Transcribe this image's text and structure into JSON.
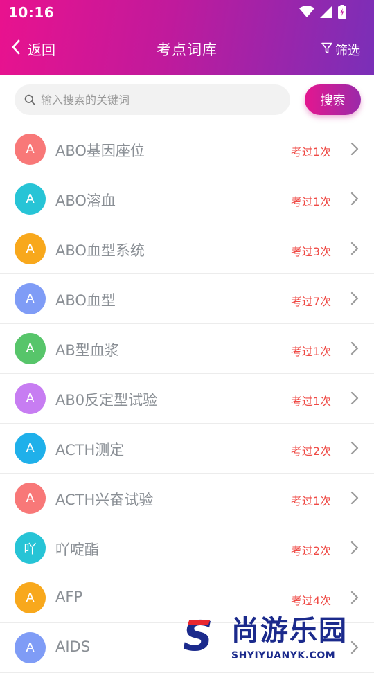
{
  "status_bar": {
    "time": "10:16"
  },
  "header": {
    "back_label": "返回",
    "title": "考点词库",
    "filter_label": "筛选"
  },
  "search": {
    "placeholder": "输入搜索的关键词",
    "value": "",
    "button_label": "搜索"
  },
  "colors": {
    "header_start": "#e9128e",
    "header_end": "#7a2fb8",
    "count_color": "#ef4a45"
  },
  "items": [
    {
      "initial": "A",
      "term": "ABO基因座位",
      "count": "考过1次",
      "color": "#f87878"
    },
    {
      "initial": "A",
      "term": "ABO溶血",
      "count": "考过1次",
      "color": "#27c4d6"
    },
    {
      "initial": "A",
      "term": "ABO血型系统",
      "count": "考过3次",
      "color": "#f8a81c"
    },
    {
      "initial": "A",
      "term": "ABO血型",
      "count": "考过7次",
      "color": "#7f9cf6"
    },
    {
      "initial": "A",
      "term": "AB型血浆",
      "count": "考过1次",
      "color": "#57c56a"
    },
    {
      "initial": "A",
      "term": "AB0反定型试验",
      "count": "考过1次",
      "color": "#c77df2"
    },
    {
      "initial": "A",
      "term": "ACTH测定",
      "count": "考过2次",
      "color": "#1fb0ea"
    },
    {
      "initial": "A",
      "term": "ACTH兴奋试验",
      "count": "考过1次",
      "color": "#f87878"
    },
    {
      "initial": "吖",
      "term": "吖啶酯",
      "count": "考过2次",
      "color": "#27c4d6"
    },
    {
      "initial": "A",
      "term": "AFP",
      "count": "考过4次",
      "color": "#f8a81c"
    },
    {
      "initial": "A",
      "term": "AIDS",
      "count": "",
      "color": "#7f9cf6"
    }
  ],
  "watermark": {
    "brand": "尚游乐园",
    "url": "SHYIYUANYK.COM"
  }
}
